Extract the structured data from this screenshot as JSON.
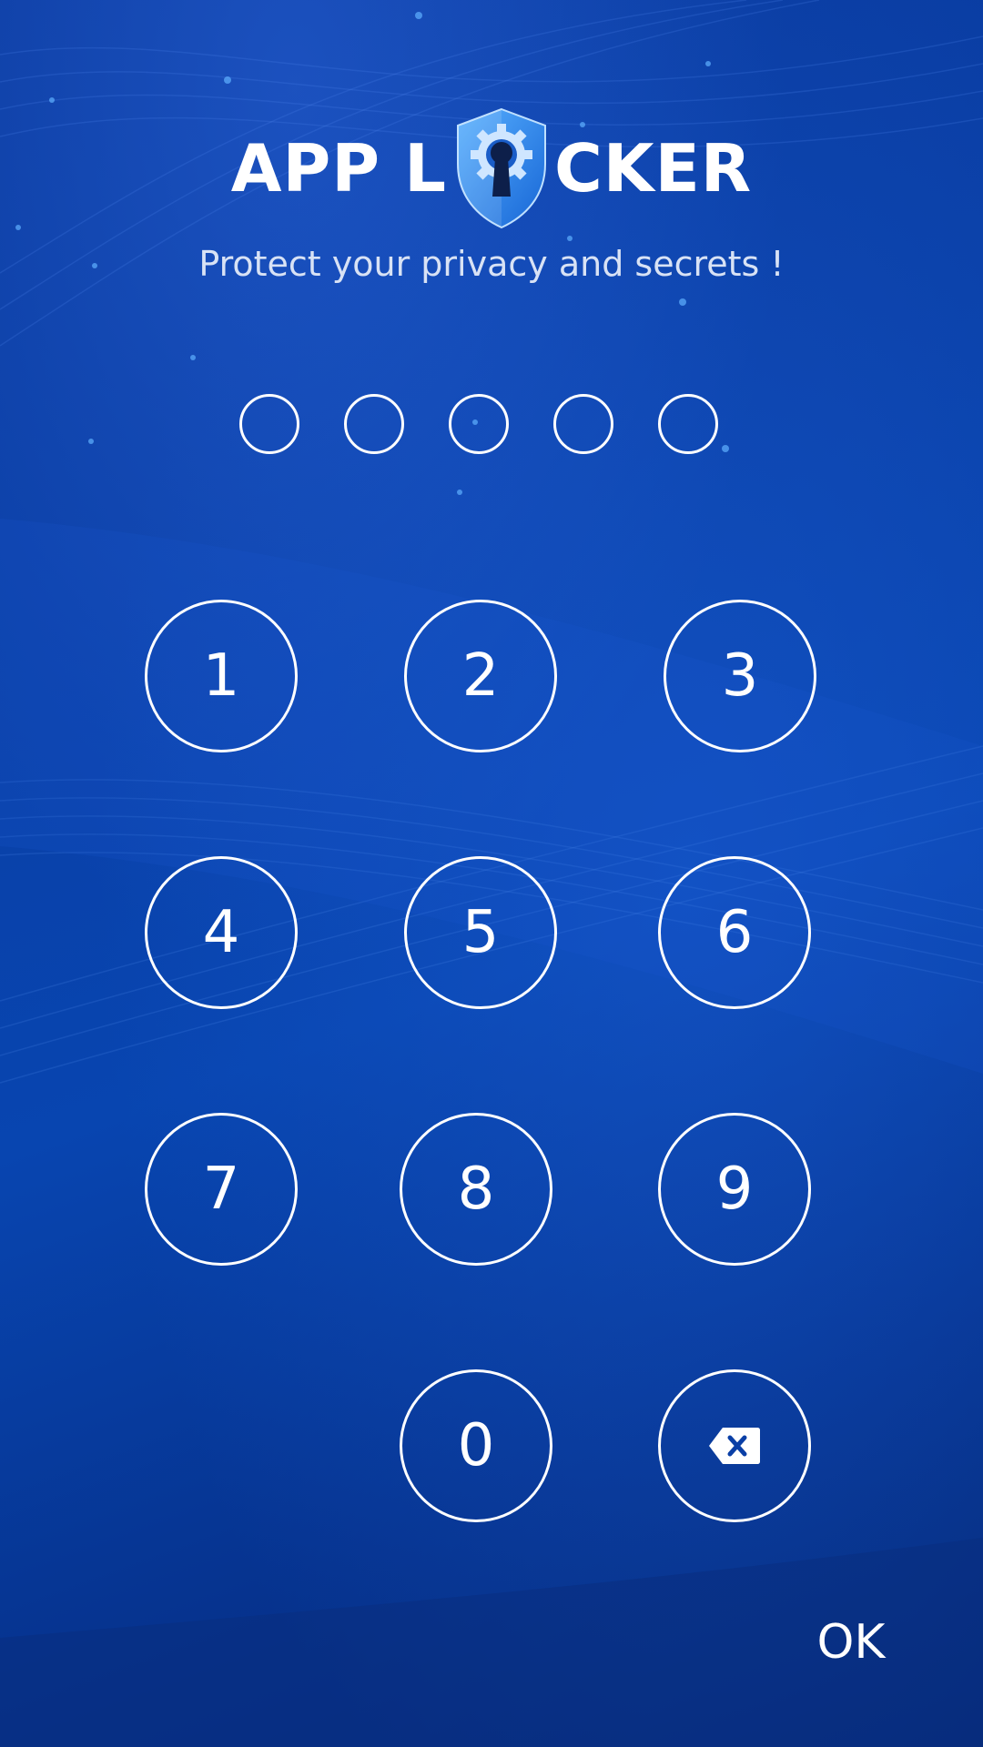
{
  "header": {
    "logo_left": "APP L",
    "logo_right": "CKER",
    "subtitle": "Protect your privacy and secrets !"
  },
  "pin": {
    "length": 5,
    "entered": 0
  },
  "keypad": {
    "keys": [
      "1",
      "2",
      "3",
      "4",
      "5",
      "6",
      "7",
      "8",
      "9",
      "0"
    ],
    "backspace_icon": "backspace-icon"
  },
  "footer": {
    "ok_label": "OK"
  },
  "colors": {
    "background": "#0a3fa6",
    "foreground": "#ffffff",
    "shield_accent": "#2f8ff0"
  }
}
